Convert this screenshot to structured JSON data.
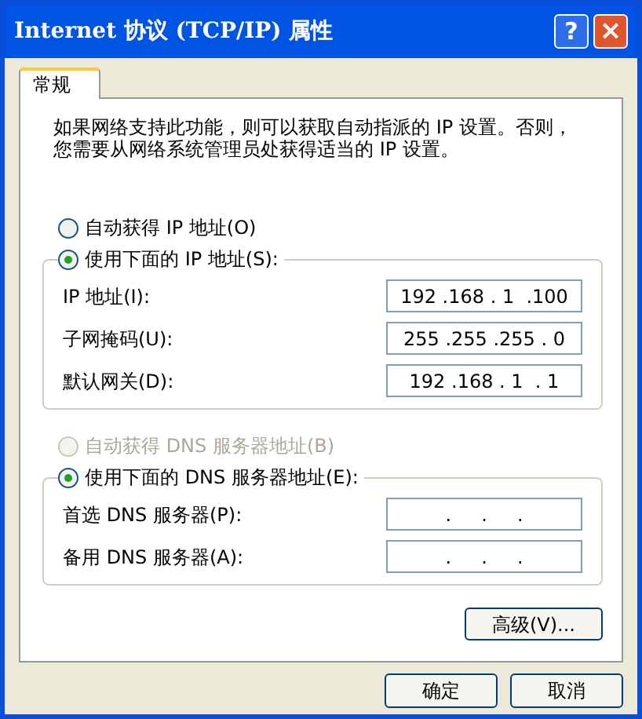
{
  "window": {
    "title": "Internet 协议 (TCP/IP) 属性",
    "title_buttons": [
      "?",
      "×"
    ]
  },
  "tabs": [
    {
      "label": "常规",
      "selected": true
    }
  ],
  "description": "如果网络支持此功能，则可以获取自动指派的 IP 设置。否则，您需要从网络系统管理员处获得适当的 IP 设置。",
  "sections": [
    {
      "options": [
        {
          "label": "自动获得 IP 地址(O)",
          "selected": false,
          "disabled": false
        },
        {
          "label": "使用下面的 IP 地址(S):",
          "selected": true,
          "disabled": false
        }
      ],
      "fields": [
        {
          "label": "IP 地址(I):",
          "value": "192 .168 . 1  .100"
        },
        {
          "label": "子网掩码(U):",
          "value": "255 .255 .255 . 0"
        },
        {
          "label": "默认网关(D):",
          "value": "192 .168 . 1  . 1"
        }
      ]
    },
    {
      "options": [
        {
          "label": "自动获得 DNS 服务器地址(B)",
          "selected": false,
          "disabled": true
        },
        {
          "label": "使用下面的 DNS 服务器地址(E):",
          "selected": true,
          "disabled": false
        }
      ],
      "fields": [
        {
          "label": "首选 DNS 服务器(P):",
          "value": ".     .     ."
        },
        {
          "label": "备用 DNS 服务器(A):",
          "value": ".     .     ."
        }
      ]
    }
  ],
  "advanced_button": "高级(V)...",
  "buttons": [
    "确定",
    "取消"
  ]
}
